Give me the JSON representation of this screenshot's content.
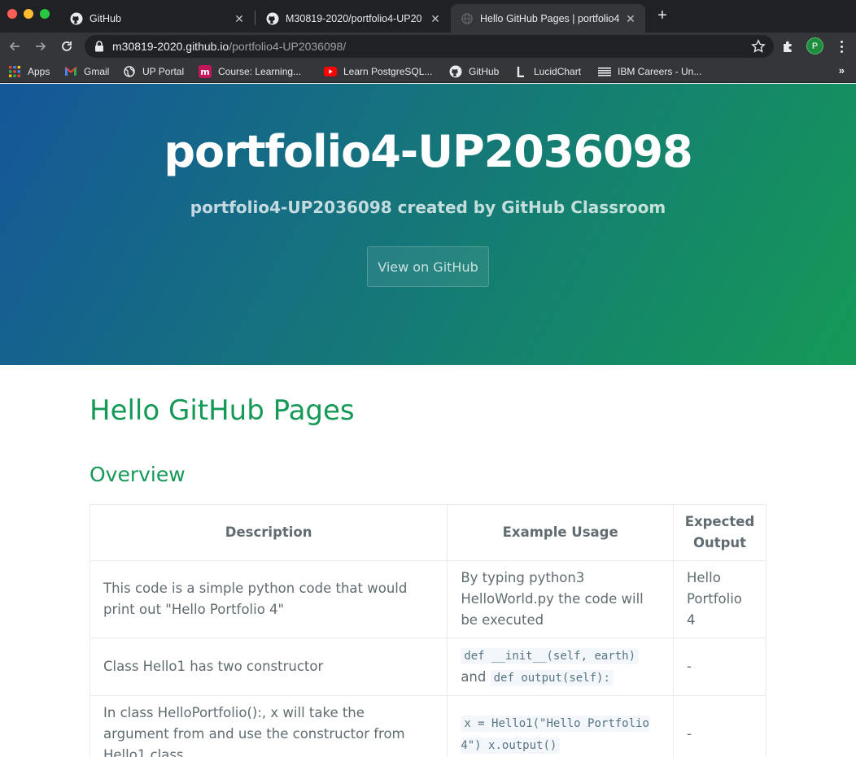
{
  "browser": {
    "tabs": [
      {
        "title": "GitHub",
        "active": false
      },
      {
        "title": "M30819-2020/portfolio4-UP20",
        "active": false
      },
      {
        "title": "Hello GitHub Pages | portfolio4",
        "active": true
      }
    ],
    "url_host": "m30819-2020.github.io",
    "url_path": "/portfolio4-UP2036098/",
    "profile_initial": "P",
    "bookmarks": [
      "Apps",
      "Gmail",
      "UP Portal",
      "Course: Learning...",
      "Learn PostgreSQL...",
      "GitHub",
      "LucidChart",
      "IBM Careers - Un..."
    ],
    "more_bookmarks": "»"
  },
  "header": {
    "project_name": "portfolio4-UP2036098",
    "tagline": "portfolio4-UP2036098 created by GitHub Classroom",
    "button": "View on GitHub"
  },
  "main": {
    "title": "Hello GitHub Pages",
    "section_title": "Overview",
    "table": {
      "headers": [
        "Description",
        "Example Usage",
        "Expected Output"
      ],
      "rows": [
        {
          "description": "This code is a simple python code that would print out \"Hello Portfolio 4\"",
          "usage_text": "By typing python3 HelloWorld.py the code will be executed",
          "output": "Hello Portfolio 4"
        },
        {
          "description": "Class Hello1 has two constructor",
          "usage_code1": "def __init__(self, earth)",
          "usage_and": "and",
          "usage_code2": "def output(self):",
          "output": "-"
        },
        {
          "description": "In class HelloPortfolio():, x will take the argument from and use the constructor from Hello1 class",
          "usage_code": "x = Hello1(\"Hello Portfolio 4\") x.output()",
          "output": "-"
        }
      ]
    }
  },
  "colors": {
    "gradient_start": "#155799",
    "gradient_end": "#159957",
    "heading_green": "#159957",
    "text": "#606c71"
  }
}
